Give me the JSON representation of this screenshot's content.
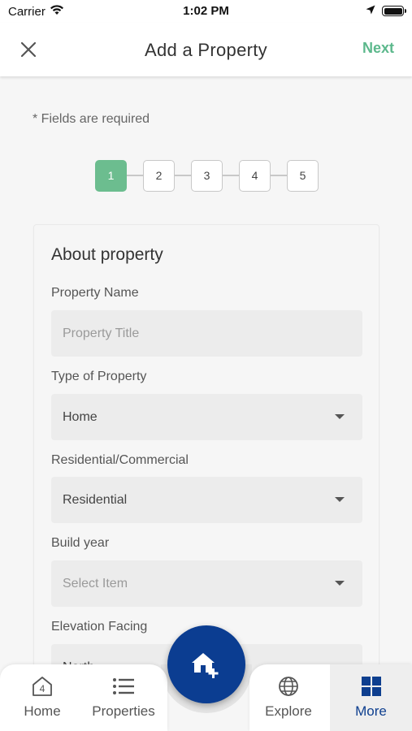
{
  "status_bar": {
    "carrier": "Carrier",
    "time": "1:02 PM"
  },
  "header": {
    "title": "Add a Property",
    "next_label": "Next"
  },
  "required_note": "* Fields are required",
  "stepper": {
    "steps": [
      "1",
      "2",
      "3",
      "4",
      "5"
    ],
    "active_step": "1"
  },
  "form": {
    "section_title": "About property",
    "fields": [
      {
        "label": "Property Name",
        "placeholder": "Property Title",
        "value": ""
      },
      {
        "label": "Type of Property",
        "value": "Home",
        "type": "select"
      },
      {
        "label": "Residential/Commercial",
        "value": "Residential",
        "type": "select"
      },
      {
        "label": "Build year",
        "placeholder": "Select Item",
        "value": "",
        "type": "select"
      },
      {
        "label": "Elevation Facing",
        "value": "North",
        "type": "select"
      }
    ]
  },
  "bottom_nav": {
    "items": [
      {
        "label": "Home",
        "icon": "home-badge-icon",
        "badge": "4"
      },
      {
        "label": "Properties",
        "icon": "list-icon"
      },
      {
        "label": "Explore",
        "icon": "globe-icon"
      },
      {
        "label": "More",
        "icon": "grid-icon",
        "active": true
      }
    ],
    "fab_icon": "add-home-icon"
  },
  "colors": {
    "accent_green": "#5cb88c",
    "active_step": "#6cbd8f",
    "brand_blue": "#0b3d91"
  }
}
